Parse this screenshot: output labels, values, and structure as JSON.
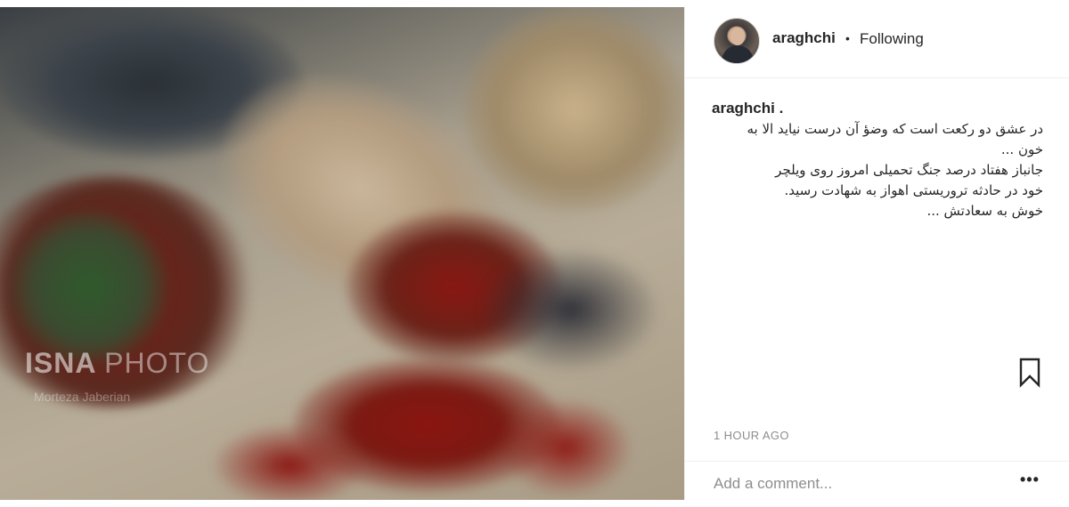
{
  "photo": {
    "watermark_bold": "ISNA",
    "watermark_light": "PHOTO",
    "watermark_sub": "Morteza Jaberian"
  },
  "header": {
    "username": "araghchi",
    "separator": "•",
    "follow_status": "Following"
  },
  "caption": {
    "username": "araghchi",
    "punctuation": ".",
    "lines": [
      "در عشق دو رکعت است که وضؤ آن درست نیاید الا به",
      "خون ...",
      "جانباز هفتاد درصد جنگ تحمیلی امروز روی ویلچر",
      "خود در حادثه تروریستی اهواز به شهادت رسید.",
      "خوش به سعادتش ..."
    ]
  },
  "actions": {
    "bookmark_icon": "bookmark-icon"
  },
  "timestamp": "1 HOUR AGO",
  "comment": {
    "placeholder": "Add a comment...",
    "more_label": "•••"
  }
}
